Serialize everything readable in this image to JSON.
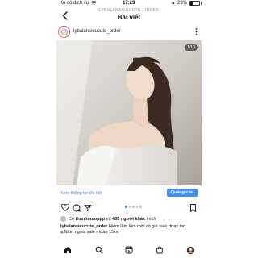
{
  "status_bar": {
    "carrier": "Ko có dịch vụ",
    "time": "17:29",
    "battery_text": "29%",
    "battery_level": 0.29
  },
  "header": {
    "subtitle": "LYBALANSIEUCUTE_ORDER",
    "title": "Bài viết"
  },
  "post": {
    "username": "lybalansieucute_order",
    "counter": "1/10",
    "cta_link": "Xem thông tin chi tiết",
    "cta_button": "Quảng cáo",
    "carousel_pages": 5,
    "carousel_active": 1,
    "likes": {
      "prefix": "Có",
      "user": "thanhmuoppp",
      "middle": "và",
      "count": "485 người khác",
      "suffix": "thích"
    },
    "caption": {
      "user": "lybalansieucute_order",
      "text": "Hiếm lắm lắm mới có giá sale rtnay mn ạ.Năm ngoái sale r toàn 15xx"
    }
  },
  "icons": {
    "back": "chevron-left-icon",
    "more": "more-vertical-icon",
    "like": "heart-icon",
    "comment": "comment-icon",
    "share": "send-icon",
    "save": "bookmark-icon",
    "home": "home-icon",
    "search": "search-icon",
    "reels": "reels-icon",
    "shop": "shop-icon",
    "profile": "profile-icon"
  },
  "colors": {
    "accent": "#3f8ff0",
    "link": "#3578e5"
  }
}
